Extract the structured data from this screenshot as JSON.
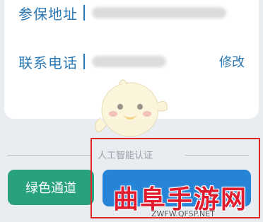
{
  "form": {
    "address_label": "参保地址",
    "phone_label": "联系电话",
    "edit_label": "修改"
  },
  "divider": {
    "label": "人工智能认证"
  },
  "buttons": {
    "green_channel_label": "绿色通道",
    "ai_auth_label": ""
  },
  "watermark": {
    "title": "曲阜手游网",
    "url": "ZWFW.QFSP.NET"
  },
  "colors": {
    "primary_blue": "#2a78b4",
    "green": "#27a17e",
    "button_blue": "#2584d6",
    "highlight_red": "#e02525"
  }
}
